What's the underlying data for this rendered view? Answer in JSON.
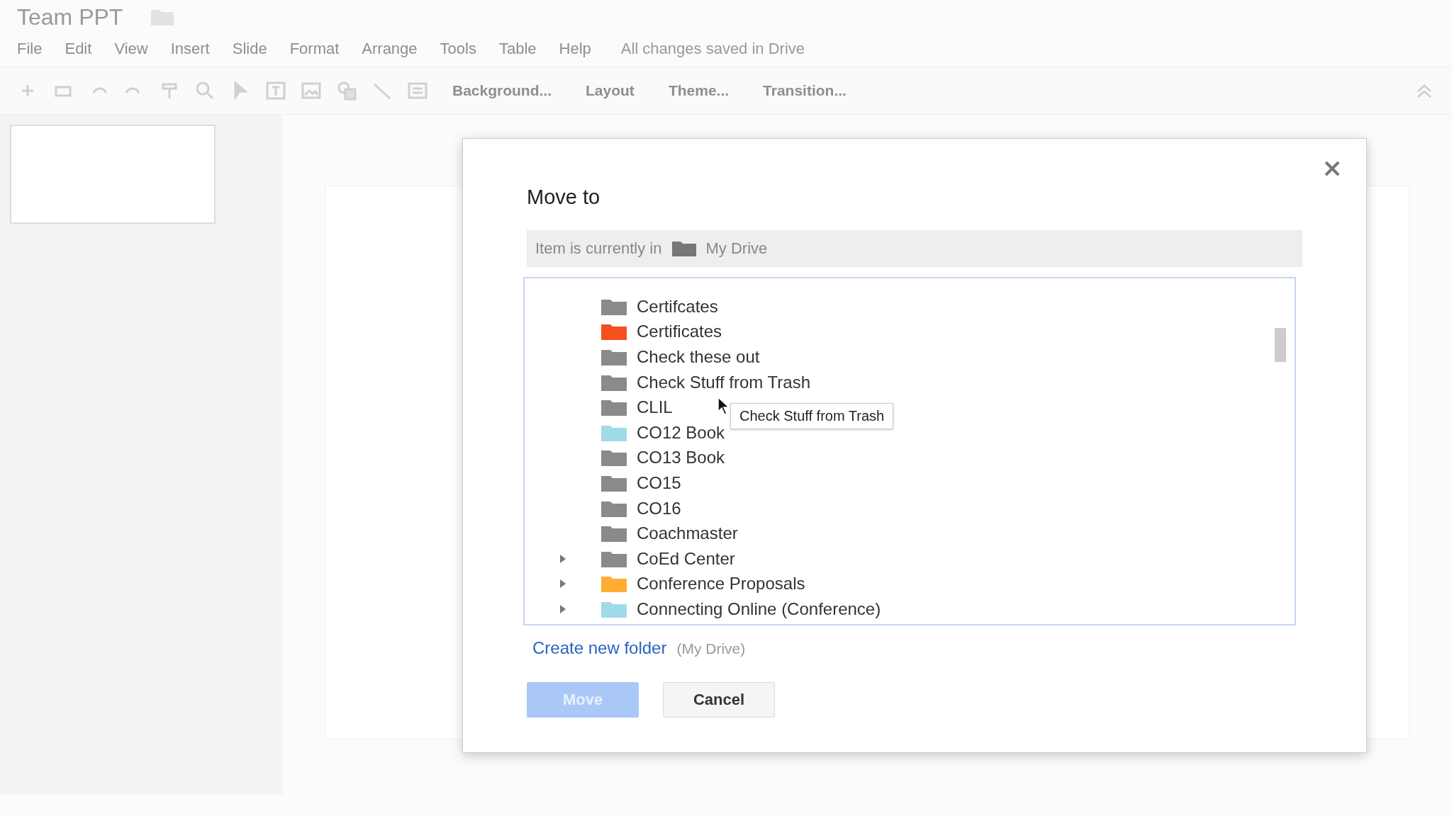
{
  "doc": {
    "title": "Team PPT",
    "status": "All changes saved in Drive"
  },
  "menu": [
    "File",
    "Edit",
    "View",
    "Insert",
    "Slide",
    "Format",
    "Arrange",
    "Tools",
    "Table",
    "Help"
  ],
  "toolbar": {
    "buttons": [
      "Background...",
      "Layout",
      "Theme...",
      "Transition..."
    ]
  },
  "dialog": {
    "title": "Move to",
    "location_label": "Item is currently in",
    "location": "My Drive",
    "folders": [
      {
        "name": "Certifcates",
        "color": "#8a8a8a",
        "expandable": false
      },
      {
        "name": "Certificates",
        "color": "#f4511e",
        "expandable": false
      },
      {
        "name": "Check these out",
        "color": "#8a8a8a",
        "expandable": false
      },
      {
        "name": "Check Stuff from Trash",
        "color": "#8a8a8a",
        "expandable": false
      },
      {
        "name": "CLIL",
        "color": "#8a8a8a",
        "expandable": false
      },
      {
        "name": "CO12 Book",
        "color": "#9fdbe8",
        "expandable": false
      },
      {
        "name": "CO13 Book",
        "color": "#8a8a8a",
        "expandable": false
      },
      {
        "name": "CO15",
        "color": "#8a8a8a",
        "expandable": false
      },
      {
        "name": "CO16",
        "color": "#8a8a8a",
        "expandable": false
      },
      {
        "name": "Coachmaster",
        "color": "#8a8a8a",
        "expandable": false
      },
      {
        "name": "CoEd Center",
        "color": "#8a8a8a",
        "expandable": true
      },
      {
        "name": "Conference Proposals",
        "color": "#ffad33",
        "expandable": true
      },
      {
        "name": "Connecting Online (Conference)",
        "color": "#9fdbe8",
        "expandable": true
      }
    ],
    "tooltip": "Check Stuff from Trash",
    "create_link": "Create new folder",
    "create_hint": "(My Drive)",
    "buttons": [
      {
        "label": "Move",
        "kind": "primary",
        "disabled": true
      },
      {
        "label": "Cancel",
        "kind": "secondary",
        "disabled": false
      }
    ]
  }
}
